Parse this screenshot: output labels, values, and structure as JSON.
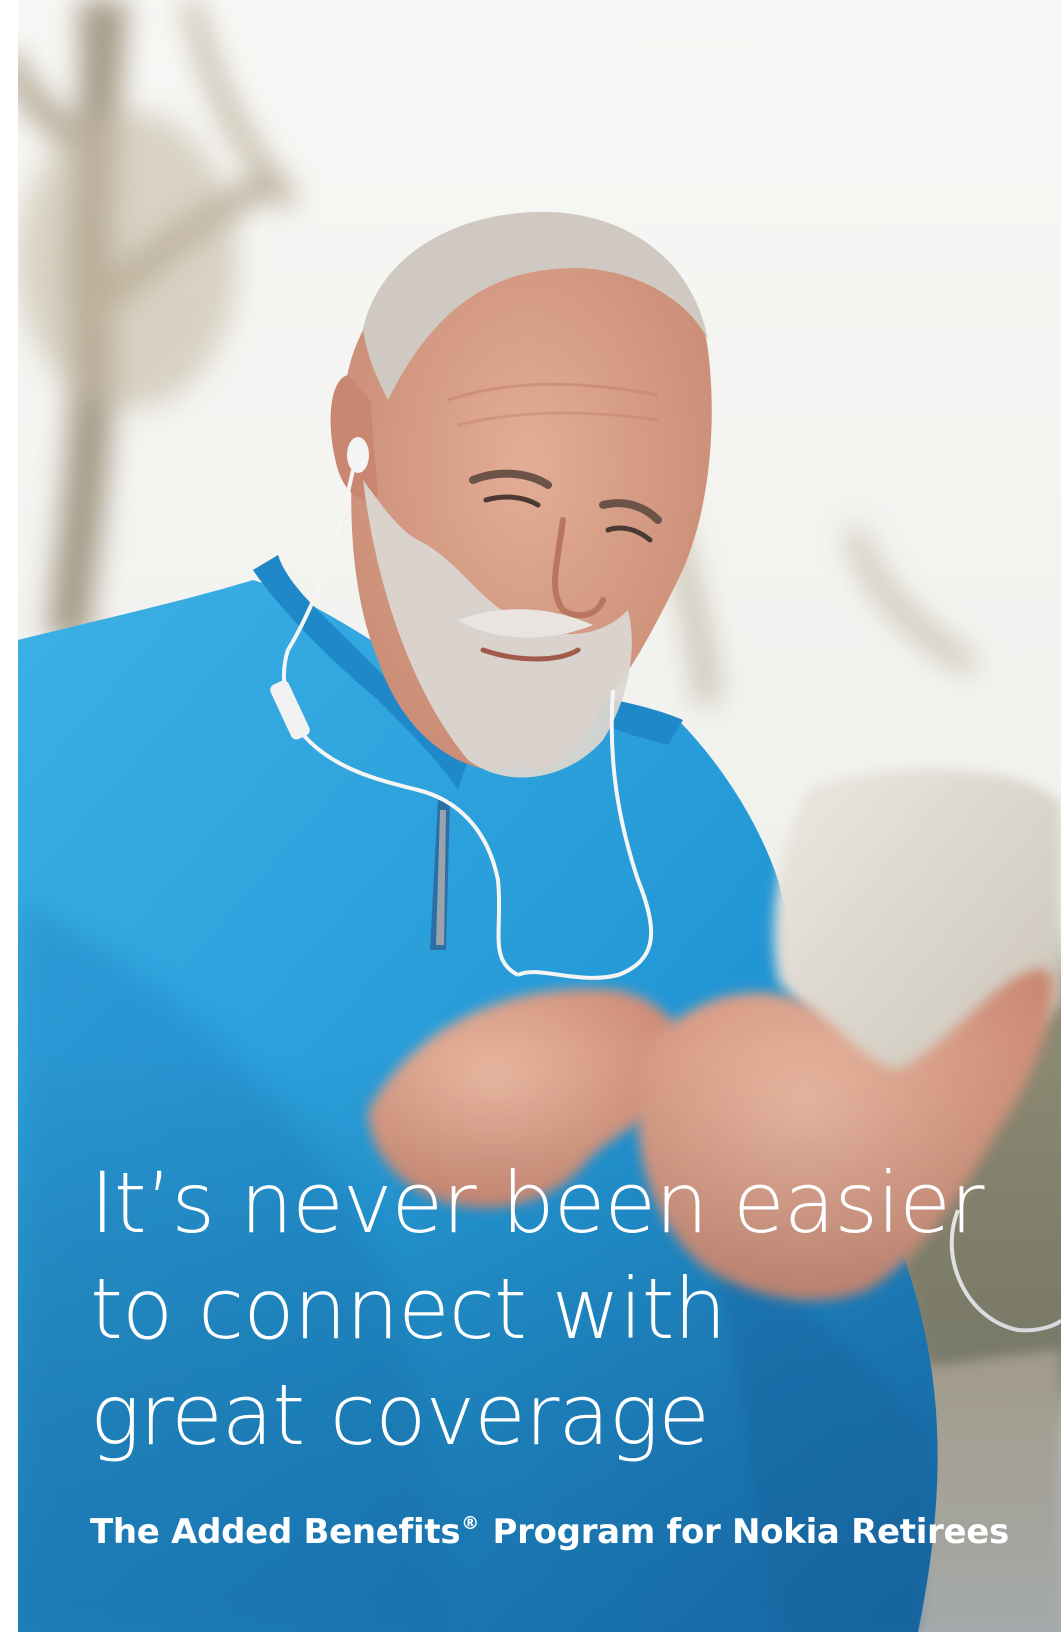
{
  "cover": {
    "headline_lines": [
      "It’s never been easier",
      "to connect with",
      "great coverage"
    ],
    "subtitle_pre": "The Added Benefits",
    "subtitle_mark": "®",
    "subtitle_post": " Program for Nokia Retirees"
  },
  "colors": {
    "jacket_blue": "#2aa3dd",
    "jacket_shadow": "#1c7fbf",
    "sky": "#f2f3f1",
    "skin": "#d9a089",
    "beard": "#d8d4cf",
    "phone": "#ddd7cd",
    "text": "#ffffff"
  }
}
